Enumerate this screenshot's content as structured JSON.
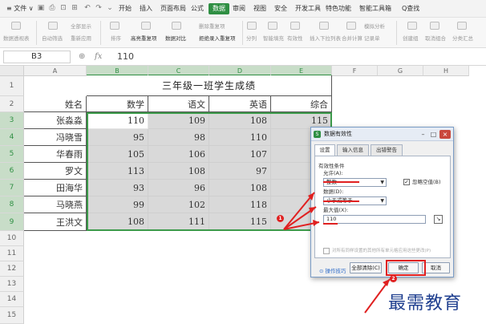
{
  "menubar": {
    "file_label": "≡ 文件 ∨",
    "tabs": [
      "开始",
      "插入",
      "页面布局",
      "公式",
      "数据",
      "审阅",
      "视图",
      "安全",
      "开发工具",
      "特色功能",
      "智能工具箱"
    ],
    "active_tab": "数据",
    "search_label": "Q查找"
  },
  "ribbon": {
    "items": [
      "数据透视表",
      "自动筛选",
      "全部显示",
      "重新应用",
      "排序",
      "高亮重复项",
      "数据对比",
      "删除重复项",
      "拒绝录入重复项",
      "分列",
      "智能填充",
      "有效性",
      "插入下拉列表",
      "合并计算",
      "模拟分析",
      "记录单",
      "创建组",
      "取消组合",
      "分类汇总"
    ]
  },
  "formula_bar": {
    "cell_ref": "B3",
    "fx_icon": "fx",
    "value": "110"
  },
  "grid": {
    "columns": [
      "A",
      "B",
      "C",
      "D",
      "E",
      "F",
      "G",
      "H"
    ],
    "rows": [
      "1",
      "2",
      "3",
      "4",
      "5",
      "6",
      "7",
      "8",
      "9",
      "10",
      "11",
      "12",
      "13",
      "14",
      "15"
    ],
    "title": "三年级一班学生成绩",
    "headers": [
      "姓名",
      "数学",
      "语文",
      "英语",
      "综合"
    ],
    "students": [
      {
        "name": "张淼淼",
        "math": "110",
        "chinese": "109",
        "english": "108",
        "total": "115"
      },
      {
        "name": "冯晓雪",
        "math": "95",
        "chinese": "98",
        "english": "110",
        "total": ""
      },
      {
        "name": "华春雨",
        "math": "105",
        "chinese": "106",
        "english": "107",
        "total": ""
      },
      {
        "name": "罗文",
        "math": "113",
        "chinese": "108",
        "english": "97",
        "total": ""
      },
      {
        "name": "田海华",
        "math": "93",
        "chinese": "96",
        "english": "108",
        "total": ""
      },
      {
        "name": "马晓燕",
        "math": "99",
        "chinese": "102",
        "english": "118",
        "total": ""
      },
      {
        "name": "王洪文",
        "math": "108",
        "chinese": "111",
        "english": "115",
        "total": ""
      }
    ]
  },
  "dialog": {
    "title": "数据有效性",
    "tabs": [
      "设置",
      "输入信息",
      "出错警告"
    ],
    "group_label": "有效性条件",
    "allow_label": "允许(A):",
    "allow_value": "整数",
    "ignore_blank_label": "忽略空值(B)",
    "data_label": "数据(D):",
    "data_value": "小于或等于",
    "max_label": "最大值(X):",
    "max_value": "110",
    "apply_all_label": "对所有同样设置的其他所有单元格应用这些更改(P)",
    "help_label": "操作技巧",
    "clear_all_label": "全部清除(C)",
    "ok_label": "确定",
    "cancel_label": "取消"
  },
  "annotations": {
    "badge1": "1",
    "badge2": "2"
  },
  "watermark": "最需教育",
  "colors": {
    "accent": "#2f8f43",
    "annotation_red": "#e02020",
    "watermark_blue": "#1f3f8f"
  }
}
